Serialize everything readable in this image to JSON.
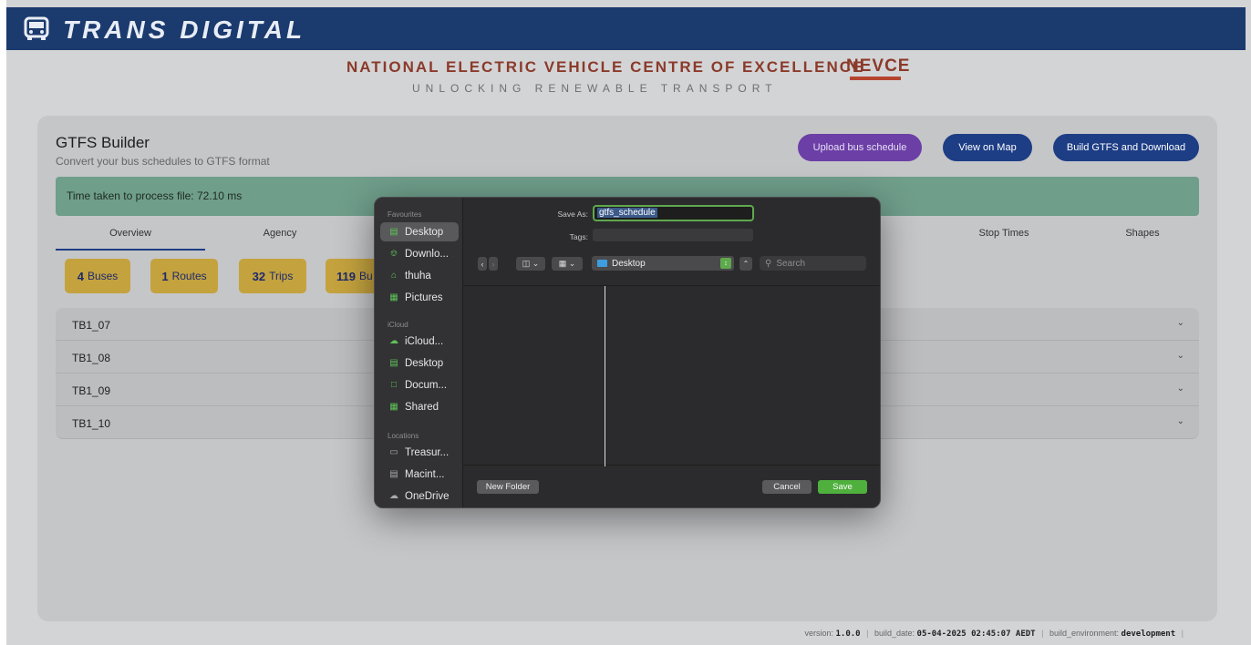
{
  "header": {
    "brand": "TRANS DIGITAL",
    "org_title": "NATIONAL ELECTRIC VEHICLE CENTRE OF EXCELLENCE",
    "org_logo": "NEVCE",
    "tagline": "UNLOCKING RENEWABLE TRANSPORT"
  },
  "card": {
    "title": "GTFS Builder",
    "subtitle": "Convert your bus schedules to GTFS format",
    "buttons": {
      "upload": "Upload bus schedule",
      "map": "View on Map",
      "build": "Build GTFS and Download"
    },
    "alert_text": "Time taken to process file: 72.10 ms",
    "tabs": [
      "Overview",
      "Agency",
      "Stop Times",
      "Shapes"
    ],
    "stats": [
      {
        "num": "4",
        "label": "Buses"
      },
      {
        "num": "1",
        "label": "Routes"
      },
      {
        "num": "32",
        "label": "Trips"
      },
      {
        "num": "119",
        "label": "Bu"
      }
    ],
    "rows": [
      "TB1_07",
      "TB1_08",
      "TB1_09",
      "TB1_10"
    ]
  },
  "footer": {
    "version_label": "version:",
    "version": "1.0.0",
    "build_date_label": "build_date:",
    "build_date": "05-04-2025 02:45:07 AEDT",
    "build_env_label": "build_environment:",
    "build_env": "development"
  },
  "dialog": {
    "sections": {
      "favourites": "Favourites",
      "icloud": "iCloud",
      "locations": "Locations"
    },
    "favourites": [
      "Desktop",
      "Downlo...",
      "thuha",
      "Pictures"
    ],
    "icloud_items": [
      "iCloud...",
      "Desktop",
      "Docum...",
      "Shared"
    ],
    "locations": [
      "Treasur...",
      "Macint...",
      "OneDrive"
    ],
    "save_as_label": "Save As:",
    "save_as_value": "gtfs_schedule",
    "tags_label": "Tags:",
    "location": "Desktop",
    "search_placeholder": "Search",
    "new_folder": "New Folder",
    "cancel": "Cancel",
    "save": "Save"
  }
}
